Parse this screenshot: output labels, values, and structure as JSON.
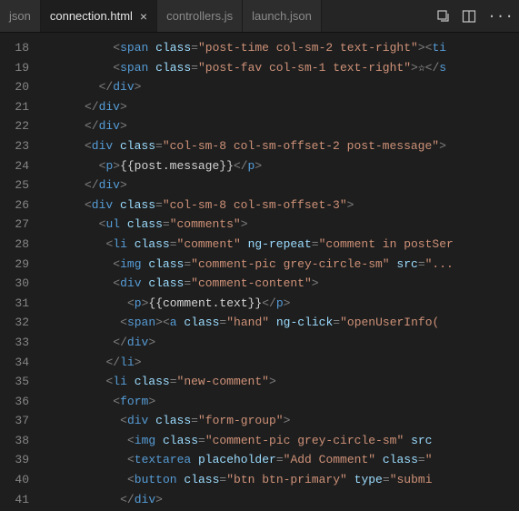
{
  "tabs": {
    "t0": {
      "label": "json"
    },
    "t1": {
      "label": "connection.html"
    },
    "t2": {
      "label": "controllers.js"
    },
    "t3": {
      "label": "launch.json"
    }
  },
  "gutter": [
    "18",
    "19",
    "20",
    "21",
    "22",
    "23",
    "24",
    "25",
    "26",
    "27",
    "28",
    "29",
    "30",
    "31",
    "32",
    "33",
    "34",
    "35",
    "36",
    "37",
    "38",
    "39",
    "40",
    "41"
  ],
  "code": {
    "l18": {
      "ind": 10,
      "tokens": [
        [
          "punc",
          "<"
        ],
        [
          "tag",
          "span"
        ],
        [
          "text",
          " "
        ],
        [
          "attr",
          "class"
        ],
        [
          "punc",
          "="
        ],
        [
          "str",
          "\"post-time col-sm-2 text-right\""
        ],
        [
          "punc",
          ">"
        ],
        [
          "punc",
          "<"
        ],
        [
          "tag",
          "ti"
        ]
      ]
    },
    "l19": {
      "ind": 10,
      "tokens": [
        [
          "punc",
          "<"
        ],
        [
          "tag",
          "span"
        ],
        [
          "text",
          " "
        ],
        [
          "attr",
          "class"
        ],
        [
          "punc",
          "="
        ],
        [
          "str",
          "\"post-fav col-sm-1 text-right\""
        ],
        [
          "punc",
          ">"
        ],
        [
          "text",
          "☆"
        ],
        [
          "punc",
          "</"
        ],
        [
          "tag",
          "s"
        ]
      ]
    },
    "l20": {
      "ind": 8,
      "tokens": [
        [
          "punc",
          "</"
        ],
        [
          "tag",
          "div"
        ],
        [
          "punc",
          ">"
        ]
      ]
    },
    "l21": {
      "ind": 6,
      "tokens": [
        [
          "punc",
          "</"
        ],
        [
          "tag",
          "div"
        ],
        [
          "punc",
          ">"
        ]
      ]
    },
    "l22": {
      "ind": 6,
      "tokens": [
        [
          "punc",
          "</"
        ],
        [
          "tag",
          "div"
        ],
        [
          "punc",
          ">"
        ]
      ]
    },
    "l23": {
      "ind": 6,
      "tokens": [
        [
          "punc",
          "<"
        ],
        [
          "tag",
          "div"
        ],
        [
          "text",
          " "
        ],
        [
          "attr",
          "class"
        ],
        [
          "punc",
          "="
        ],
        [
          "str",
          "\"col-sm-8 col-sm-offset-2 post-message\""
        ],
        [
          "punc",
          ">"
        ]
      ]
    },
    "l24": {
      "ind": 8,
      "tokens": [
        [
          "punc",
          "<"
        ],
        [
          "tag",
          "p"
        ],
        [
          "punc",
          ">"
        ],
        [
          "text",
          "{{post.message}}"
        ],
        [
          "punc",
          "</"
        ],
        [
          "tag",
          "p"
        ],
        [
          "punc",
          ">"
        ]
      ]
    },
    "l25": {
      "ind": 6,
      "tokens": [
        [
          "punc",
          "</"
        ],
        [
          "tag",
          "div"
        ],
        [
          "punc",
          ">"
        ]
      ]
    },
    "l26": {
      "ind": 6,
      "tokens": [
        [
          "punc",
          "<"
        ],
        [
          "tag",
          "div"
        ],
        [
          "text",
          " "
        ],
        [
          "attr",
          "class"
        ],
        [
          "punc",
          "="
        ],
        [
          "str",
          "\"col-sm-8 col-sm-offset-3\""
        ],
        [
          "punc",
          ">"
        ]
      ]
    },
    "l27": {
      "ind": 8,
      "tokens": [
        [
          "punc",
          "<"
        ],
        [
          "tag",
          "ul"
        ],
        [
          "text",
          " "
        ],
        [
          "attr",
          "class"
        ],
        [
          "punc",
          "="
        ],
        [
          "str",
          "\"comments\""
        ],
        [
          "punc",
          ">"
        ]
      ]
    },
    "l28": {
      "ind": 9,
      "tokens": [
        [
          "punc",
          "<"
        ],
        [
          "tag",
          "li"
        ],
        [
          "text",
          " "
        ],
        [
          "attr",
          "class"
        ],
        [
          "punc",
          "="
        ],
        [
          "str",
          "\"comment\""
        ],
        [
          "text",
          " "
        ],
        [
          "attr",
          "ng-repeat"
        ],
        [
          "punc",
          "="
        ],
        [
          "str",
          "\"comment in postSer"
        ]
      ]
    },
    "l29": {
      "ind": 10,
      "tokens": [
        [
          "punc",
          "<"
        ],
        [
          "tag",
          "img"
        ],
        [
          "text",
          " "
        ],
        [
          "attr",
          "class"
        ],
        [
          "punc",
          "="
        ],
        [
          "str",
          "\"comment-pic grey-circle-sm\""
        ],
        [
          "text",
          " "
        ],
        [
          "attr",
          "src"
        ],
        [
          "punc",
          "="
        ],
        [
          "str",
          "\"..."
        ]
      ]
    },
    "l30": {
      "ind": 10,
      "tokens": [
        [
          "punc",
          "<"
        ],
        [
          "tag",
          "div"
        ],
        [
          "text",
          " "
        ],
        [
          "attr",
          "class"
        ],
        [
          "punc",
          "="
        ],
        [
          "str",
          "\"comment-content\""
        ],
        [
          "punc",
          ">"
        ]
      ]
    },
    "l31": {
      "ind": 12,
      "tokens": [
        [
          "punc",
          "<"
        ],
        [
          "tag",
          "p"
        ],
        [
          "punc",
          ">"
        ],
        [
          "text",
          "{{comment.text}}"
        ],
        [
          "punc",
          "</"
        ],
        [
          "tag",
          "p"
        ],
        [
          "punc",
          ">"
        ]
      ]
    },
    "l32": {
      "ind": 11,
      "tokens": [
        [
          "punc",
          "<"
        ],
        [
          "tag",
          "span"
        ],
        [
          "punc",
          ">"
        ],
        [
          "punc",
          "<"
        ],
        [
          "tag",
          "a"
        ],
        [
          "text",
          " "
        ],
        [
          "attr",
          "class"
        ],
        [
          "punc",
          "="
        ],
        [
          "str",
          "\"hand\""
        ],
        [
          "text",
          " "
        ],
        [
          "attr",
          "ng-click"
        ],
        [
          "punc",
          "="
        ],
        [
          "str",
          "\"openUserInfo("
        ]
      ]
    },
    "l33": {
      "ind": 10,
      "tokens": [
        [
          "punc",
          "</"
        ],
        [
          "tag",
          "div"
        ],
        [
          "punc",
          ">"
        ]
      ]
    },
    "l34": {
      "ind": 9,
      "tokens": [
        [
          "punc",
          "</"
        ],
        [
          "tag",
          "li"
        ],
        [
          "punc",
          ">"
        ]
      ]
    },
    "l35": {
      "ind": 9,
      "tokens": [
        [
          "punc",
          "<"
        ],
        [
          "tag",
          "li"
        ],
        [
          "text",
          " "
        ],
        [
          "attr",
          "class"
        ],
        [
          "punc",
          "="
        ],
        [
          "str",
          "\"new-comment\""
        ],
        [
          "punc",
          ">"
        ]
      ]
    },
    "l36": {
      "ind": 10,
      "tokens": [
        [
          "punc",
          "<"
        ],
        [
          "tag",
          "form"
        ],
        [
          "punc",
          ">"
        ]
      ]
    },
    "l37": {
      "ind": 11,
      "tokens": [
        [
          "punc",
          "<"
        ],
        [
          "tag",
          "div"
        ],
        [
          "text",
          " "
        ],
        [
          "attr",
          "class"
        ],
        [
          "punc",
          "="
        ],
        [
          "str",
          "\"form-group\""
        ],
        [
          "punc",
          ">"
        ]
      ]
    },
    "l38": {
      "ind": 12,
      "tokens": [
        [
          "punc",
          "<"
        ],
        [
          "tag",
          "img"
        ],
        [
          "text",
          " "
        ],
        [
          "attr",
          "class"
        ],
        [
          "punc",
          "="
        ],
        [
          "str",
          "\"comment-pic grey-circle-sm\""
        ],
        [
          "text",
          " "
        ],
        [
          "attr",
          "src"
        ]
      ]
    },
    "l39": {
      "ind": 12,
      "tokens": [
        [
          "punc",
          "<"
        ],
        [
          "tag",
          "textarea"
        ],
        [
          "text",
          " "
        ],
        [
          "attr",
          "placeholder"
        ],
        [
          "punc",
          "="
        ],
        [
          "str",
          "\"Add Comment\""
        ],
        [
          "text",
          " "
        ],
        [
          "attr",
          "class"
        ],
        [
          "punc",
          "="
        ],
        [
          "str",
          "\""
        ]
      ]
    },
    "l40": {
      "ind": 12,
      "tokens": [
        [
          "punc",
          "<"
        ],
        [
          "tag",
          "button"
        ],
        [
          "text",
          " "
        ],
        [
          "attr",
          "class"
        ],
        [
          "punc",
          "="
        ],
        [
          "str",
          "\"btn btn-primary\""
        ],
        [
          "text",
          " "
        ],
        [
          "attr",
          "type"
        ],
        [
          "punc",
          "="
        ],
        [
          "str",
          "\"submi"
        ]
      ]
    },
    "l41": {
      "ind": 11,
      "tokens": [
        [
          "punc",
          "</"
        ],
        [
          "tag",
          "div"
        ],
        [
          "punc",
          ">"
        ]
      ]
    }
  }
}
